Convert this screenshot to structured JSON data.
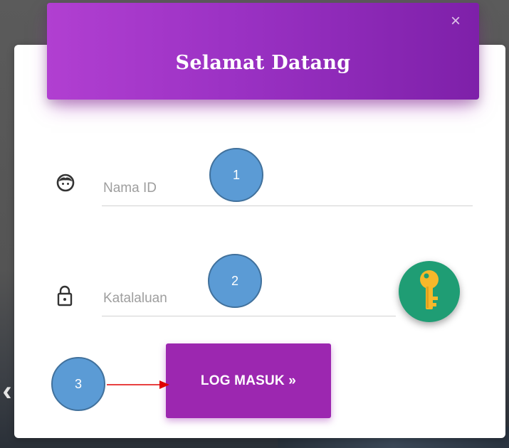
{
  "modal": {
    "title": "Selamat Datang",
    "close_glyph": "×",
    "close_icon": "close-icon"
  },
  "username": {
    "placeholder": "Nama ID",
    "value": "",
    "icon": "face-icon"
  },
  "password": {
    "placeholder": "Katalaluan",
    "value": "",
    "icon": "lock-icon"
  },
  "key_button": {
    "icon": "key-icon",
    "color": "#1f9d74"
  },
  "login_button": {
    "label": "LOG MASUK »",
    "color": "#9c27b0"
  },
  "annotations": {
    "callout_1": "1",
    "callout_2": "2",
    "callout_3": "3",
    "callout_color": "#5b9bd5",
    "arrow_color": "#e00000"
  },
  "colors": {
    "header_gradient_start": "#b13fd1",
    "header_gradient_end": "#7e20a9"
  }
}
